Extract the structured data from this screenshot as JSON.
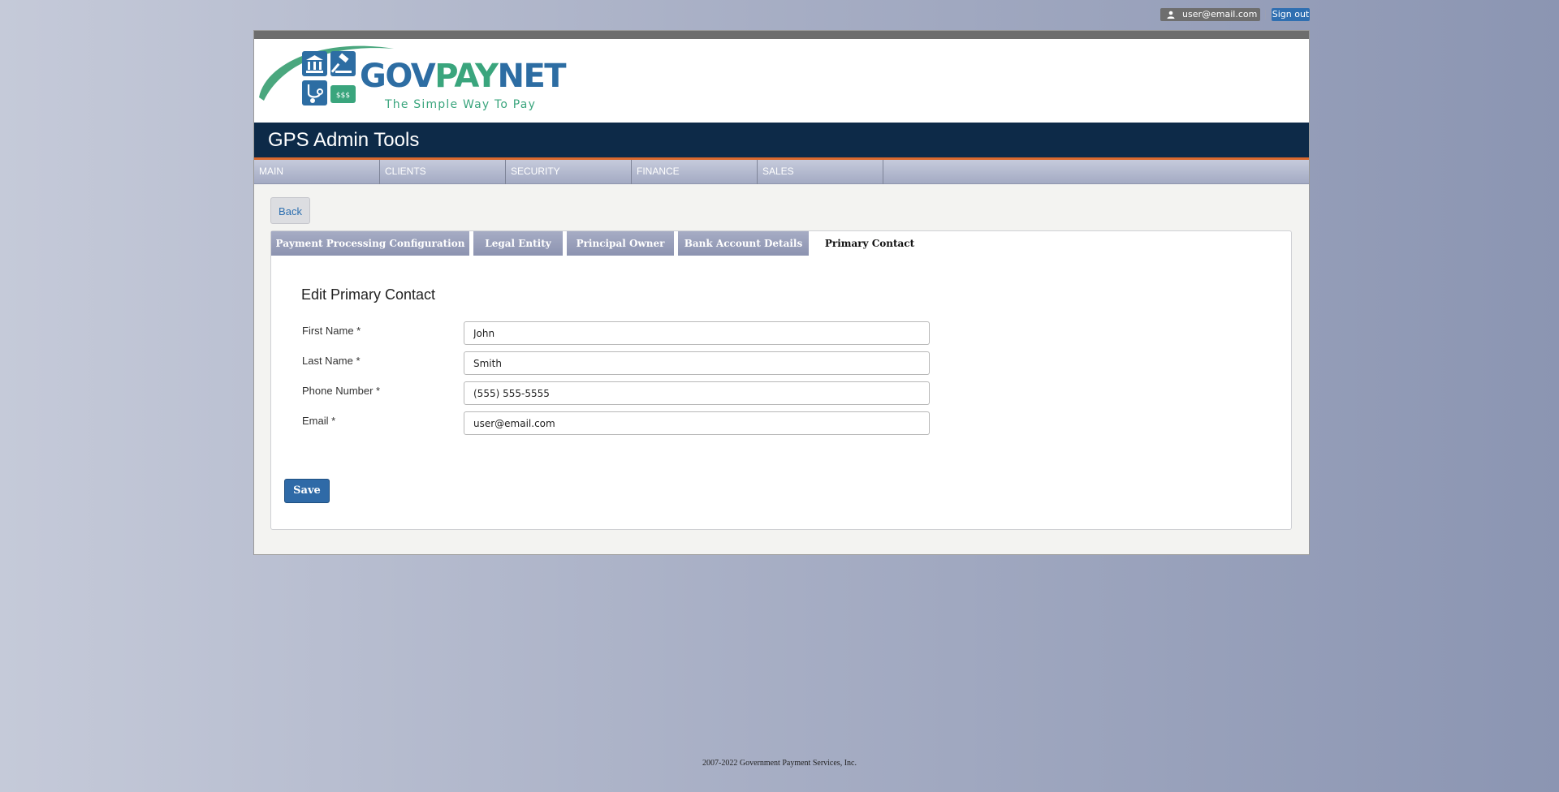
{
  "header": {
    "user_email": "user@email.com",
    "sign_out_label": "Sign out",
    "user_icon": "user-icon"
  },
  "logo": {
    "gov": "GOV",
    "pay": "PAY",
    "net": "NET",
    "tagline": "The Simple Way To Pay",
    "icons": [
      "courthouse-icon",
      "gavel-icon",
      "stethoscope-icon",
      "money-icon"
    ]
  },
  "app": {
    "title": "GPS Admin Tools"
  },
  "nav": {
    "items": [
      {
        "label": "MAIN"
      },
      {
        "label": "CLIENTS"
      },
      {
        "label": "SECURITY"
      },
      {
        "label": "FINANCE"
      },
      {
        "label": "SALES"
      }
    ]
  },
  "back_label": "Back",
  "tabs": [
    {
      "label": "Payment Processing Configuration"
    },
    {
      "label": "Legal Entity"
    },
    {
      "label": "Principal Owner"
    },
    {
      "label": "Bank Account Details"
    },
    {
      "label": "Primary Contact",
      "active": true
    }
  ],
  "form": {
    "title": "Edit Primary Contact",
    "fields": [
      {
        "label": "First Name *",
        "value": "John"
      },
      {
        "label": "Last Name *",
        "value": "Smith"
      },
      {
        "label": "Phone Number *",
        "value": "(555) 555-5555"
      },
      {
        "label": "Email *",
        "value": "user@email.com"
      }
    ],
    "save_label": "Save"
  },
  "footer": {
    "text": "2007-2022 Government Payment Services, Inc."
  },
  "colors": {
    "title_bar": "#0d2a48",
    "accent_orange": "#d9692e",
    "brand_blue": "#2d6da3",
    "brand_green": "#3aa57d",
    "save_button": "#2f6aa7"
  }
}
